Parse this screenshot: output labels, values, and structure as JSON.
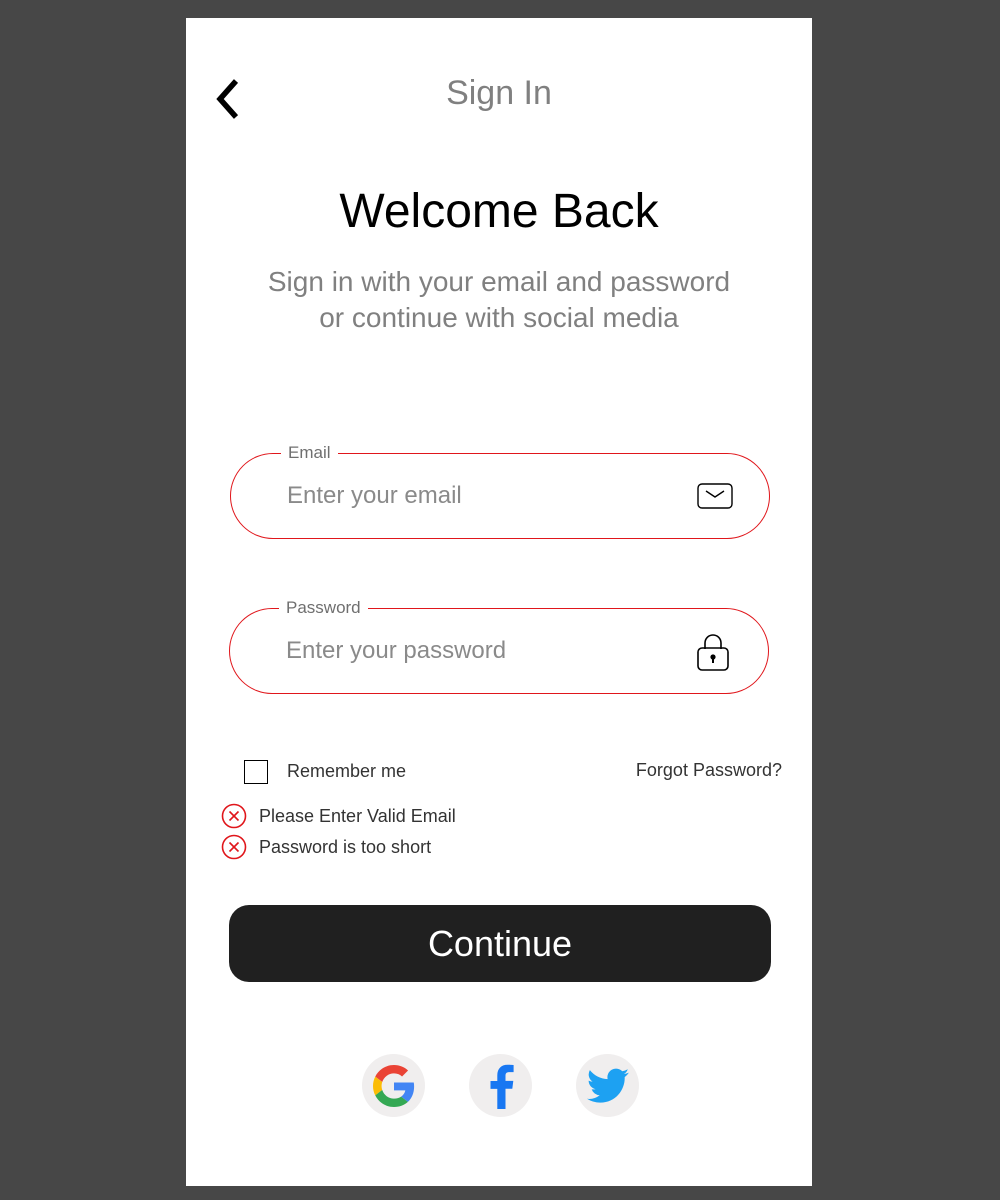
{
  "header": {
    "title": "Sign In",
    "back_icon": "chevron-left-icon"
  },
  "welcome": {
    "title": "Welcome Back",
    "subtitle_line1": "Sign in with your email and password",
    "subtitle_line2": "or continue with social media"
  },
  "form": {
    "email": {
      "label": "Email",
      "placeholder": "Enter your email",
      "value": "",
      "icon": "mail-icon"
    },
    "password": {
      "label": "Password",
      "placeholder": "Enter your password",
      "value": "",
      "icon": "lock-icon"
    },
    "remember_label": "Remember me",
    "remember_checked": false,
    "forgot_label": "Forgot Password?"
  },
  "errors": [
    {
      "text": "Please Enter Valid Email",
      "icon": "error-x-icon"
    },
    {
      "text": "Password is too short",
      "icon": "error-x-icon"
    }
  ],
  "continue_label": "Continue",
  "social": [
    {
      "icon": "google-icon"
    },
    {
      "icon": "facebook-icon"
    },
    {
      "icon": "twitter-icon"
    }
  ],
  "colors": {
    "background": "#474747",
    "card": "#ffffff",
    "error": "#e0161b",
    "button": "#202020",
    "social_bg": "#f0eeee",
    "facebook": "#1877f2",
    "twitter": "#1da1f2"
  }
}
